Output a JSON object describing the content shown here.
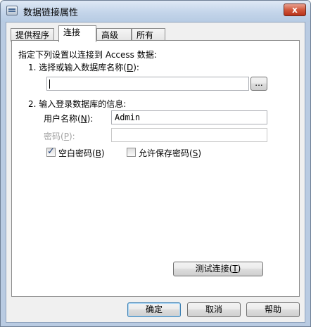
{
  "window": {
    "title": "数据链接属性",
    "close_glyph": "x"
  },
  "tabs": [
    {
      "label": "提供程序"
    },
    {
      "label": "连接"
    },
    {
      "label": "高级"
    },
    {
      "label": "所有"
    }
  ],
  "connection": {
    "intro": "指定下列设置以连接到 Access 数据:",
    "step1_prefix": "1. 选择或输入数据库名称(",
    "step1_key": "D",
    "step1_suffix": "):",
    "db_name_value": "",
    "browse_label": "...",
    "step2_label": "2. 输入登录数据库的信息:",
    "username_label_prefix": "用户名称(",
    "username_label_key": "N",
    "username_label_suffix": "):",
    "username_value": "Admin",
    "password_label_prefix": "密码(",
    "password_label_key": "P",
    "password_label_suffix": "):",
    "password_value": "",
    "blank_password_prefix": "空白密码(",
    "blank_password_key": "B",
    "blank_password_suffix": ")",
    "blank_password_checked": true,
    "allow_save_prefix": "允许保存密码(",
    "allow_save_key": "S",
    "allow_save_suffix": ")",
    "allow_save_checked": false,
    "test_prefix": "测试连接(",
    "test_key": "T",
    "test_suffix": ")"
  },
  "footer": {
    "ok_label": "确定",
    "cancel_label": "取消",
    "help_label": "帮助"
  }
}
